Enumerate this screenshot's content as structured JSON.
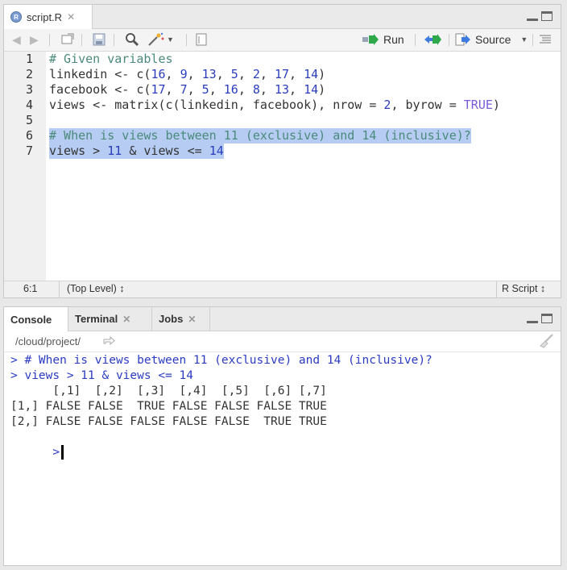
{
  "editor": {
    "tab": {
      "badge": "R",
      "label": "script.R"
    },
    "toolbar": {
      "run_label": "Run",
      "source_label": "Source"
    },
    "line_numbers": [
      "1",
      "2",
      "3",
      "4",
      "5",
      "6",
      "7"
    ],
    "lines": [
      [
        {
          "t": "# Given variables",
          "c": "cm"
        }
      ],
      [
        {
          "t": "linkedin <- c(",
          "c": ""
        },
        {
          "t": "16",
          "c": "num"
        },
        {
          "t": ", ",
          "c": ""
        },
        {
          "t": "9",
          "c": "num"
        },
        {
          "t": ", ",
          "c": ""
        },
        {
          "t": "13",
          "c": "num"
        },
        {
          "t": ", ",
          "c": ""
        },
        {
          "t": "5",
          "c": "num"
        },
        {
          "t": ", ",
          "c": ""
        },
        {
          "t": "2",
          "c": "num"
        },
        {
          "t": ", ",
          "c": ""
        },
        {
          "t": "17",
          "c": "num"
        },
        {
          "t": ", ",
          "c": ""
        },
        {
          "t": "14",
          "c": "num"
        },
        {
          "t": ")",
          "c": ""
        }
      ],
      [
        {
          "t": "facebook <- c(",
          "c": ""
        },
        {
          "t": "17",
          "c": "num"
        },
        {
          "t": ", ",
          "c": ""
        },
        {
          "t": "7",
          "c": "num"
        },
        {
          "t": ", ",
          "c": ""
        },
        {
          "t": "5",
          "c": "num"
        },
        {
          "t": ", ",
          "c": ""
        },
        {
          "t": "16",
          "c": "num"
        },
        {
          "t": ", ",
          "c": ""
        },
        {
          "t": "8",
          "c": "num"
        },
        {
          "t": ", ",
          "c": ""
        },
        {
          "t": "13",
          "c": "num"
        },
        {
          "t": ", ",
          "c": ""
        },
        {
          "t": "14",
          "c": "num"
        },
        {
          "t": ")",
          "c": ""
        }
      ],
      [
        {
          "t": "views <- matrix(c(linkedin, facebook), nrow = ",
          "c": ""
        },
        {
          "t": "2",
          "c": "num"
        },
        {
          "t": ", byrow = ",
          "c": ""
        },
        {
          "t": "TRUE",
          "c": "kw"
        },
        {
          "t": ")",
          "c": ""
        }
      ],
      [],
      [
        {
          "t": "# When is views between 11 (exclusive) and 14 (inclusive)?",
          "c": "cm"
        }
      ],
      [
        {
          "t": "views > ",
          "c": ""
        },
        {
          "t": "11",
          "c": "num"
        },
        {
          "t": " & views <= ",
          "c": ""
        },
        {
          "t": "14",
          "c": "num"
        }
      ]
    ],
    "status": {
      "position": "6:1",
      "scope": "(Top Level) ↕",
      "filetype": "R Script ↕"
    }
  },
  "console": {
    "tabs": [
      {
        "label": "Console",
        "closable": false
      },
      {
        "label": "Terminal",
        "closable": true
      },
      {
        "label": "Jobs",
        "closable": true
      }
    ],
    "path": "/cloud/project/",
    "lines": [
      {
        "t": "> # When is views between 11 (exclusive) and 14 (inclusive)?",
        "c": "blue"
      },
      {
        "t": "> views > 11 & views <= 14",
        "c": "blue"
      },
      {
        "t": "      [,1]  [,2]  [,3]  [,4]  [,5]  [,6] [,7]",
        "c": "out"
      },
      {
        "t": "[1,] FALSE FALSE  TRUE FALSE FALSE FALSE TRUE",
        "c": "out"
      },
      {
        "t": "[2,] FALSE FALSE FALSE FALSE FALSE  TRUE TRUE",
        "c": "out"
      }
    ],
    "prompt": ">"
  },
  "colors": {
    "highlight": "#b6ccf2",
    "console_input": "#2b3cc2",
    "comment": "#4a8a7a",
    "number": "#2a3ebc"
  }
}
